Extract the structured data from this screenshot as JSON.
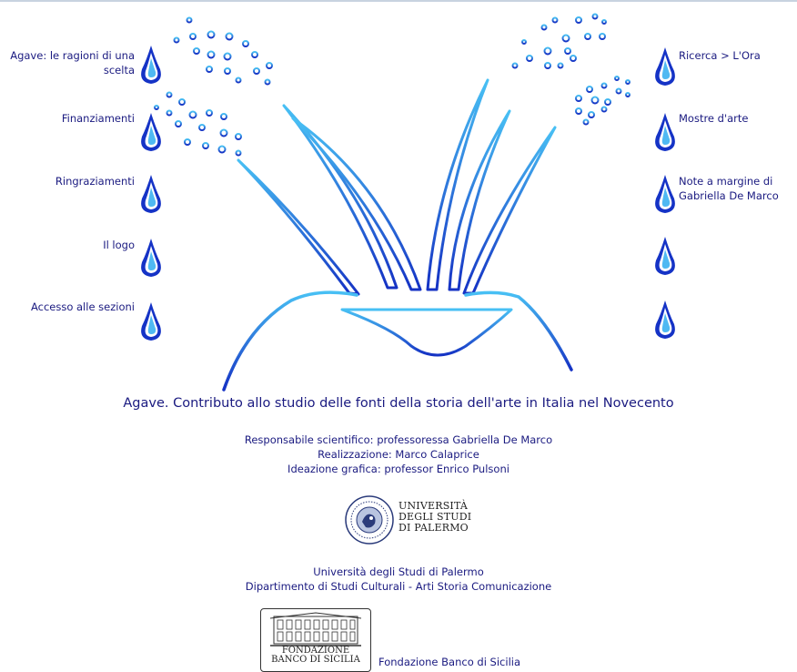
{
  "nav_left": [
    {
      "label": "Agave: le ragioni di una scelta"
    },
    {
      "label": "Finanziamenti"
    },
    {
      "label": "Ringraziamenti"
    },
    {
      "label": "Il logo"
    },
    {
      "label": "Accesso alle sezioni"
    }
  ],
  "nav_right": [
    {
      "label": "Ricerca > L'Ora"
    },
    {
      "label": "Mostre d'arte"
    },
    {
      "label": "Note a margine di Gabriella De Marco"
    },
    {
      "label": ""
    },
    {
      "label": ""
    }
  ],
  "title": "Agave. Contributo allo studio delle fonti della storia dell'arte in Italia nel Novecento",
  "credits": {
    "responsabile": "Responsabile scientifico: professoressa Gabriella De Marco",
    "realizzazione": "Realizzazione: Marco Calaprice",
    "ideazione": "Ideazione grafica: professor Enrico Pulsoni"
  },
  "university": {
    "wordmark_line1": "UNIVERSITÀ",
    "wordmark_line2": "DEGLI STUDI",
    "wordmark_line3": "DI PALERMO",
    "name": "Università degli Studi di Palermo",
    "department": "Dipartimento di Studi Culturali - Arti Storia Comunicazione"
  },
  "foundation": {
    "logo_line1": "FONDAZIONE",
    "logo_line2": "BANCO DI SICILIA",
    "name": "Fondazione Banco di Sicilia"
  },
  "colors": {
    "text": "#1a1a80",
    "drop_dark": "#1533c6",
    "drop_light": "#3fb0f0"
  }
}
